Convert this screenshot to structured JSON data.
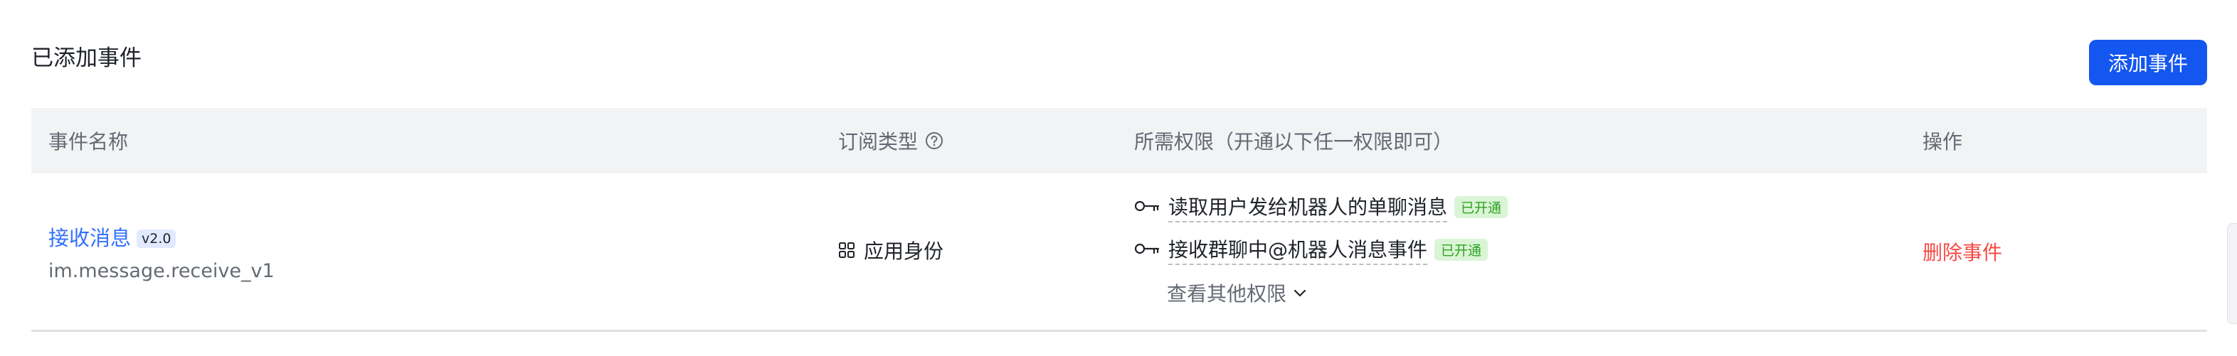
{
  "section": {
    "title": "已添加事件",
    "add_button": "添加事件"
  },
  "table": {
    "headers": {
      "event_name": "事件名称",
      "subscription_type": "订阅类型",
      "permissions": "所需权限（开通以下任一权限即可）",
      "actions": "操作"
    },
    "rows": [
      {
        "event_name": "接收消息",
        "version": "v2.0",
        "event_key": "im.message.receive_v1",
        "subscription_type": "应用身份",
        "permissions": [
          {
            "label": "读取用户发给机器人的单聊消息",
            "status": "已开通"
          },
          {
            "label": "接收群聊中@机器人消息事件",
            "status": "已开通"
          }
        ],
        "more_permissions": "查看其他权限",
        "action": "删除事件"
      }
    ]
  },
  "icons": {
    "help": "question-circle-icon",
    "subscription": "grid-icon",
    "permission": "key-icon",
    "more": "chevron-down-icon"
  },
  "colors": {
    "primary": "#1456f0",
    "link": "#3370ff",
    "danger": "#f54a45",
    "success": "#2ea121"
  }
}
